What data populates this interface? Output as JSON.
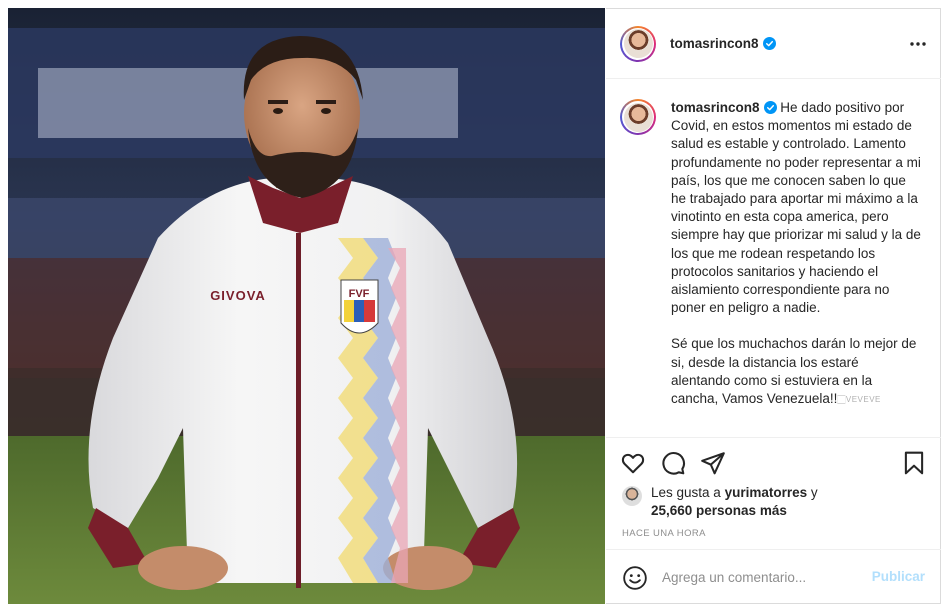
{
  "post": {
    "username": "tomasrincon8",
    "menu_icon": "more-horizontal-icon",
    "verified_icon": "verified-badge-icon",
    "photo": {
      "jacket_brand": "GIVOVA",
      "crest_text": "FVF"
    },
    "caption": {
      "username": "tomasrincon8",
      "paragraph1": "He dado positivo por Covid, en estos momentos mi estado de salud es estable y controlado. Lamento profundamente no poder representar a mi país, los que me conocen saben lo que he trabajado para aportar mi máximo a la vinotinto en esta copa america, pero siempre hay que priorizar mi salud y la de los que me rodean respetando los protocolos sanitarios y haciendo el aislamiento correspondiente para no poner en peligro a nadie.",
      "paragraph2": "Sé que los muchachos darán lo mejor de si, desde la distancia los estaré alentando como si estuviera en la cancha, Vamos Venezuela!!",
      "trailing_emoji_text": "🏻VEVEVE"
    },
    "actions": {
      "like_icon": "heart-icon",
      "comment_icon": "comment-icon",
      "share_icon": "share-icon",
      "save_icon": "bookmark-icon"
    },
    "likes": {
      "prefix": "Les gusta a ",
      "liker": "yurimatorres",
      "conjunction": " y",
      "count_text": "25,660 personas más"
    },
    "timestamp": "HACE UNA HORA",
    "comment_box": {
      "emoji_icon": "smiley-icon",
      "placeholder": "Agrega un comentario...",
      "publish_label": "Publicar"
    }
  },
  "colors": {
    "verified_blue": "#0095f6",
    "publish_disabled": "#b2dffc",
    "border": "#dbdbdb"
  }
}
